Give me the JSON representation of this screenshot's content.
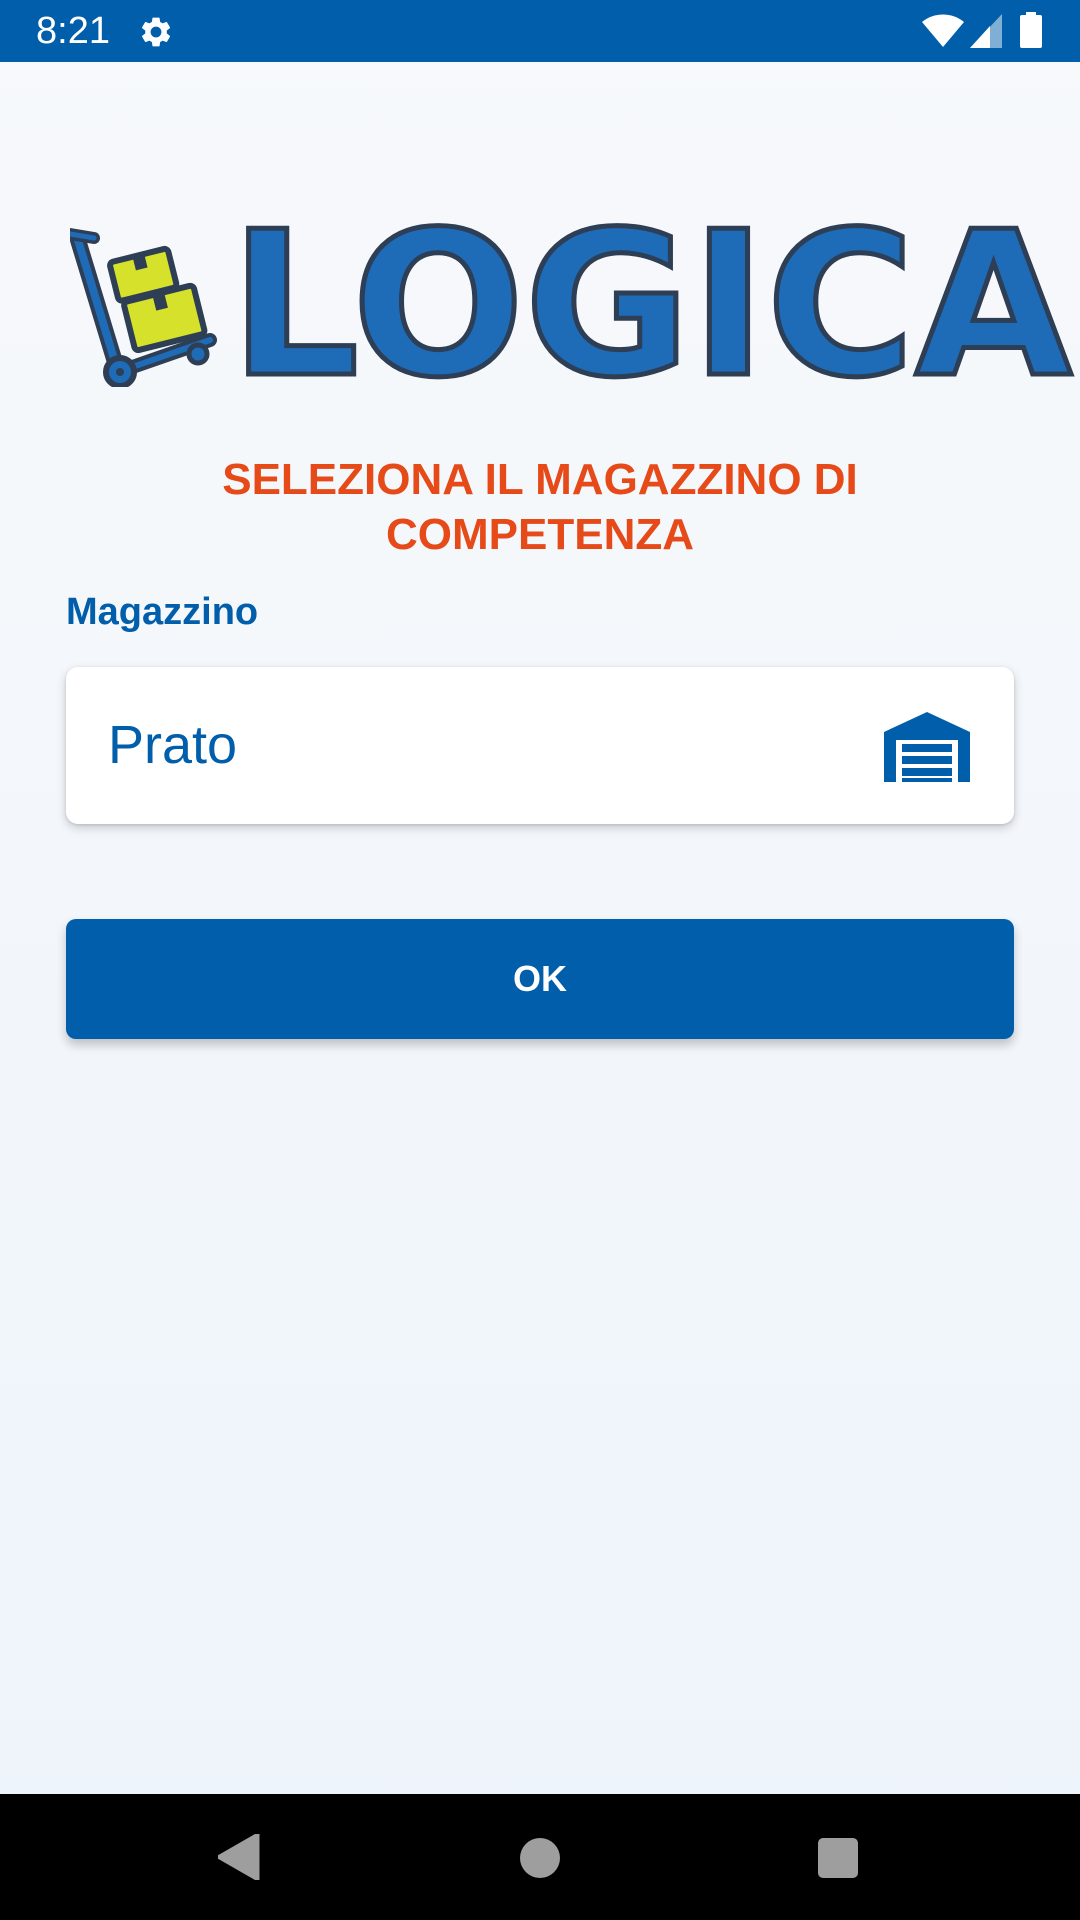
{
  "status_bar": {
    "time": "8:21",
    "icons": [
      "gear-icon",
      "wifi-icon",
      "signal-icon",
      "battery-icon"
    ],
    "background": "#015eaa"
  },
  "logo": {
    "text": "LOGICA",
    "primary_color": "#1e6bb8",
    "outline_color": "#2d3e55",
    "box_color": "#d6e12b"
  },
  "heading": {
    "line1": "SELEZIONA IL MAGAZZINO DI",
    "line2": "COMPETENZA",
    "color": "#e64a19"
  },
  "warehouse_field": {
    "label": "Magazzino",
    "value": "Prato",
    "icon": "warehouse-icon"
  },
  "actions": {
    "ok_label": "OK"
  },
  "nav_bar": {
    "buttons": [
      "back-icon",
      "home-icon",
      "recent-apps-icon"
    ]
  }
}
